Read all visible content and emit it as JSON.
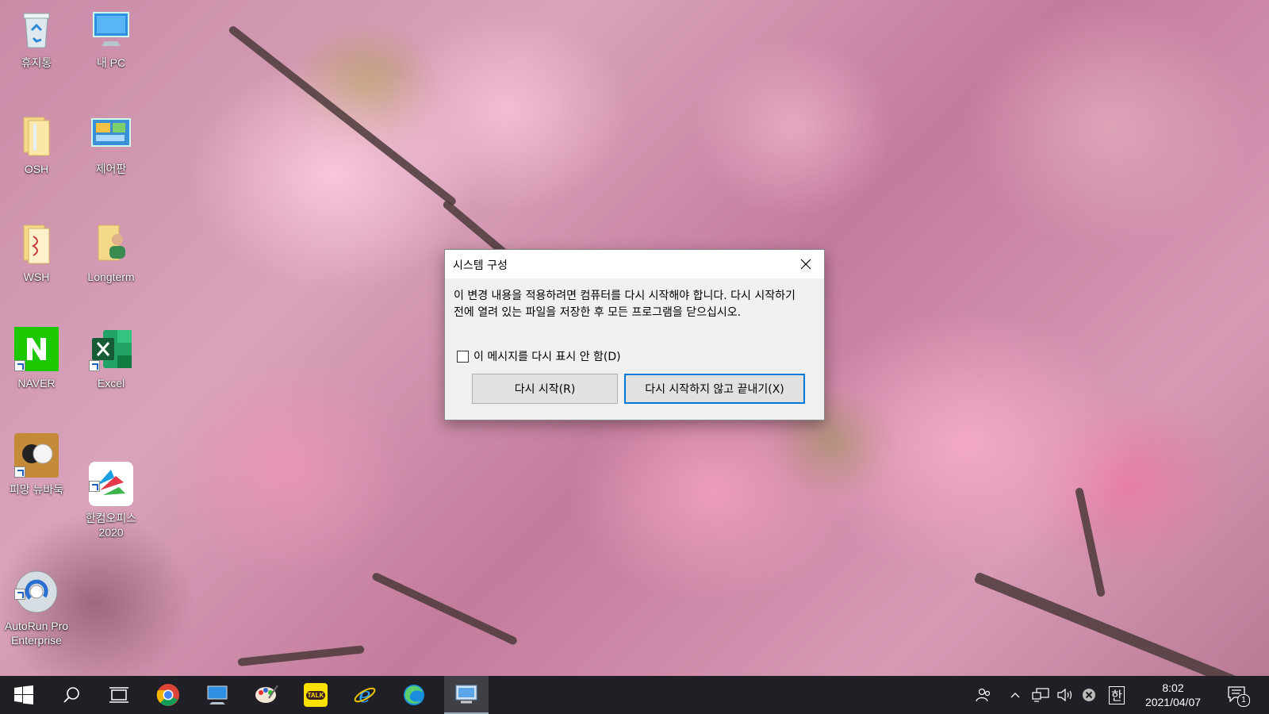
{
  "desktop": {
    "icons": [
      {
        "label": "휴지통",
        "icon": "recycle-bin-icon"
      },
      {
        "label": "내 PC",
        "icon": "this-pc-icon"
      },
      {
        "label": "OSH",
        "icon": "folder-icon"
      },
      {
        "label": "제어판",
        "icon": "control-panel-icon"
      },
      {
        "label": "WSH",
        "icon": "folder-icon"
      },
      {
        "label": "Longterm",
        "icon": "user-folder-icon"
      },
      {
        "label": "NAVER",
        "icon": "naver-icon"
      },
      {
        "label": "Excel",
        "icon": "excel-icon"
      },
      {
        "label": "피망 뉴바둑",
        "icon": "pmang-baduk-icon"
      },
      {
        "label": "한컴오피스\n2020",
        "icon": "hancom-office-icon"
      },
      {
        "label": "AutoRun Pro\nEnterprise",
        "icon": "autorun-icon"
      }
    ]
  },
  "dialog": {
    "title": "시스템 구성",
    "message": "이 변경 내용을 적용하려면 컴퓨터를 다시 시작해야 합니다. 다시 시작하기 전에 열려 있는 파일을 저장한 후 모든 프로그램을 닫으십시오.",
    "checkbox_label": "이 메시지를 다시 표시 안 함(D)",
    "checkbox_checked": false,
    "restart_label": "다시 시작(R)",
    "exit_label": "다시 시작하지 않고 끝내기(X)"
  },
  "taskbar": {
    "apps": [
      "start-icon",
      "search-icon",
      "task-view-icon",
      "chrome-icon",
      "explorer-pc-icon",
      "paint-icon",
      "kakaotalk-icon",
      "internet-explorer-icon",
      "edge-icon",
      "system-config-icon"
    ],
    "kakao_label": "TALK",
    "ime_label": "한",
    "time": "8:02",
    "date": "2021/04/07",
    "notification_count": "1"
  },
  "colors": {
    "accent": "#0078d7",
    "taskbar": "#1f1f25"
  }
}
